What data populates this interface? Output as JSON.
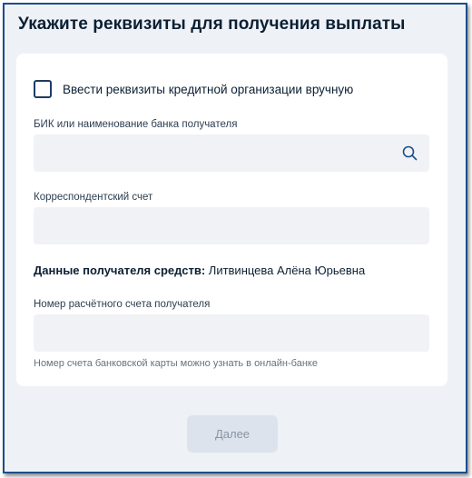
{
  "page": {
    "title": "Укажите реквизиты для получения выплаты"
  },
  "form": {
    "manual_entry_checkbox": {
      "label": "Ввести реквизиты кредитной организации вручную",
      "checked": false
    },
    "bank_field": {
      "label": "БИК или наименование банка получателя",
      "value": "",
      "icon": "search-icon"
    },
    "corr_account_field": {
      "label": "Корреспондентский счет",
      "value": ""
    },
    "recipient": {
      "label": "Данные получателя средств:",
      "name": "Литвинцева Алёна Юрьевна"
    },
    "account_field": {
      "label": "Номер расчётного счета получателя",
      "value": "",
      "hint": "Номер счета банковской карты можно узнать в онлайн-банке"
    }
  },
  "actions": {
    "next_label": "Далее"
  },
  "colors": {
    "accent": "#1b4f8a",
    "input_bg": "#f0f2f5",
    "page_bg": "#eef2f7",
    "disabled_button_bg": "#dde3ec"
  }
}
